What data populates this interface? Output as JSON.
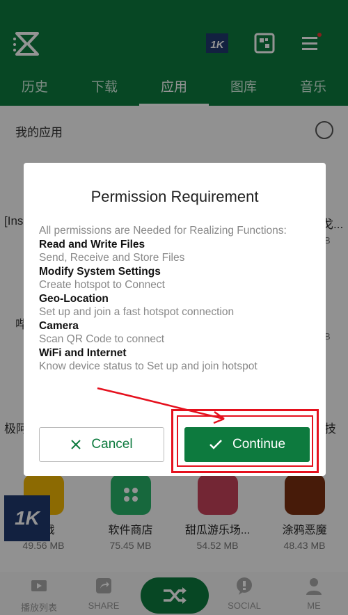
{
  "header": {
    "tabs": [
      {
        "label": "历史"
      },
      {
        "label": "下载"
      },
      {
        "label": "应用",
        "active": true
      },
      {
        "label": "图库"
      },
      {
        "label": "音乐"
      }
    ],
    "icons": [
      "hourglass-logo-icon",
      "1k-icon",
      "qr-scan-icon",
      "menu-icon"
    ],
    "accent_color": "#0d7a3e"
  },
  "content": {
    "section_title": "我的应用",
    "partial_left_1": "[Ins",
    "partial_right_1": "戈...",
    "partial_right_1_sub": "B",
    "partial_left_2": "哔",
    "partial_right_2_sub": "B",
    "partial_left_3": "极阿",
    "partial_right_3": "技",
    "apps": [
      {
        "name": "作战",
        "size": "49.56 MB"
      },
      {
        "name": "软件商店",
        "size": "75.45 MB"
      },
      {
        "name": "甜瓜游乐场...",
        "size": "54.52 MB"
      },
      {
        "name": "涂鸦恶魔",
        "size": "48.43 MB"
      }
    ],
    "badge_text": "1K"
  },
  "bottom_nav": {
    "items": [
      {
        "label": "播放列表"
      },
      {
        "label": "SHARE"
      },
      {
        "label": "SOCIAL"
      },
      {
        "label": "ME"
      }
    ]
  },
  "dialog": {
    "title": "Permission Requirement",
    "intro": "All permissions are Needed for Realizing Functions:",
    "permissions": [
      {
        "title": "Read and Write Files",
        "desc": "Send, Receive and Store Files"
      },
      {
        "title": "Modify System Settings",
        "desc": "Create hotspot to Connect"
      },
      {
        "title": "Geo-Location",
        "desc": "Set up and join a fast hotspot connection"
      },
      {
        "title": "Camera",
        "desc": "Scan QR Code to connect"
      },
      {
        "title": "WiFi and Internet",
        "desc": "Know device status to Set up and join hotspot"
      }
    ],
    "cancel_label": "Cancel",
    "continue_label": "Continue"
  },
  "annotation_color": "#e5101d"
}
